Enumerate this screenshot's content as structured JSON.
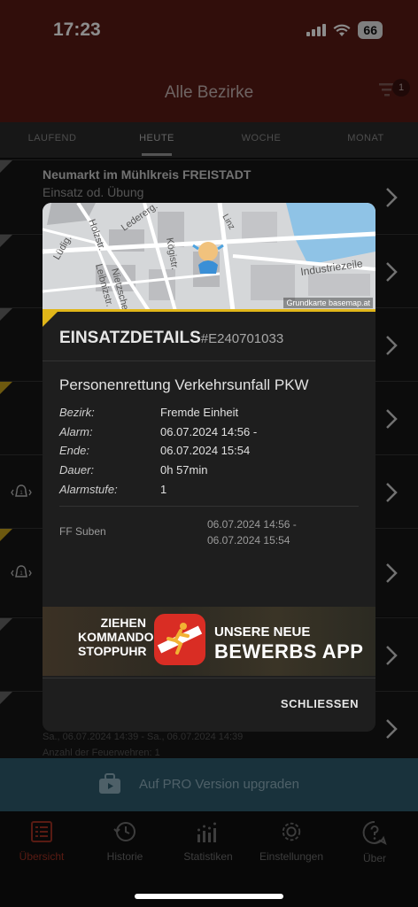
{
  "status": {
    "time": "17:23",
    "battery": "66"
  },
  "nav": {
    "title": "Alle Bezirke",
    "filter_badge": "1"
  },
  "tabs": [
    "LAUFEND",
    "HEUTE",
    "WOCHE",
    "MONAT"
  ],
  "list": {
    "first_title": "Neumarkt im Mühlkreis FREISTADT",
    "first_sub": "Einsatz od. Übung",
    "last_date": "Sa., 06.07.2024 14:39 - Sa., 06.07.2024 14:39",
    "last_count": "Anzahl der Feuerwehren: 1"
  },
  "modal": {
    "map_credit": "Grundkarte basemap.at",
    "map_labels": [
      "Holzstr.",
      "Ledererg.",
      "Kögistr.",
      "Leibnizstr.",
      "Nietzschestr.",
      "Lüdig.",
      "Industriezeile",
      "Linz"
    ],
    "header": "EINSATZDETAILS",
    "id": "#E240701033",
    "title": "Personenrettung Verkehrsunfall PKW",
    "fields": [
      {
        "k": "Bezirk:",
        "v": "Fremde Einheit"
      },
      {
        "k": "Alarm:",
        "v": "06.07.2024 14:56 -"
      },
      {
        "k": "Ende:",
        "v": "06.07.2024 15:54"
      },
      {
        "k": "Dauer:",
        "v": "0h 57min"
      },
      {
        "k": "Alarmstufe:",
        "v": "1"
      }
    ],
    "ff": {
      "name": "FF Suben",
      "start": "06.07.2024 14:56 -",
      "end": "06.07.2024 15:54"
    },
    "banner": {
      "left": [
        "ZIEHEN",
        "KOMMANDOS",
        "STOPPUHR"
      ],
      "right_1": "UNSERE NEUE",
      "right_2": "BEWERBS APP"
    },
    "close": "SCHLIESSEN"
  },
  "promo": {
    "label": "Auf PRO Version upgraden"
  },
  "tabbar": [
    "Übersicht",
    "Historie",
    "Statistiken",
    "Einstellungen",
    "Über"
  ],
  "colors": {
    "brand": "#5a1a15",
    "accent_yellow": "#e0b619",
    "active_tab": "#a03223",
    "promo": "#2e5b6e"
  }
}
